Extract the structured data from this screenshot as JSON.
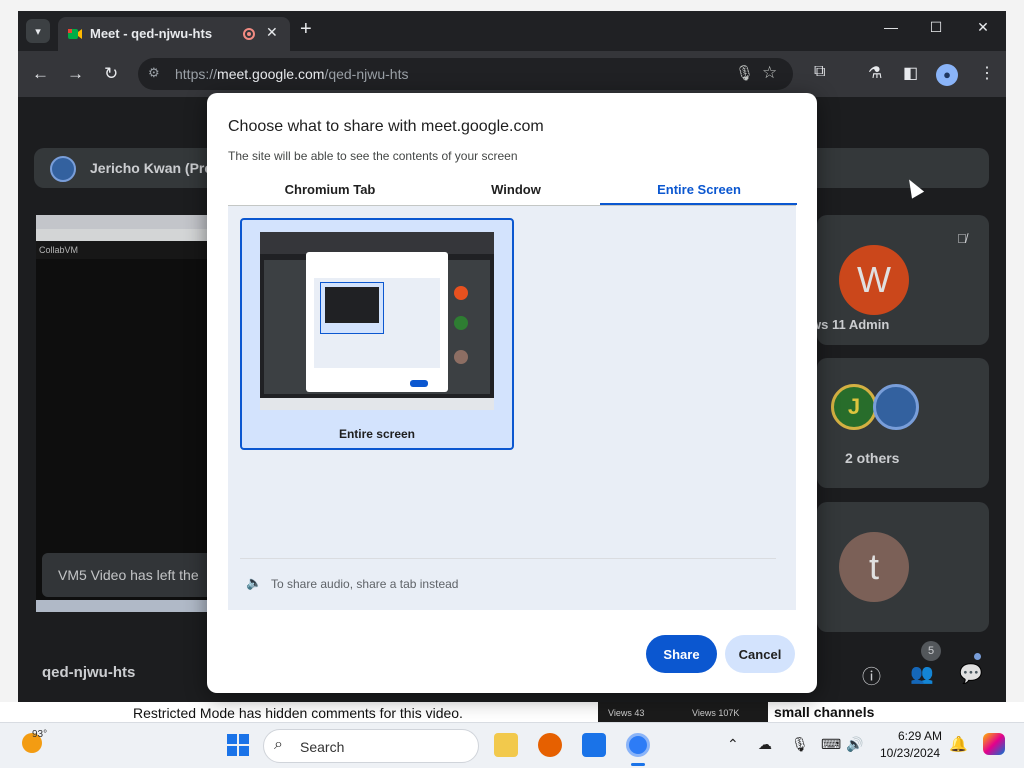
{
  "browser": {
    "tab_title": "Meet - qed-njwu-hts",
    "tab_close": "✕",
    "new_tab": "+",
    "window_controls": {
      "minimize": "—",
      "maximize": "☐",
      "close": "✕"
    },
    "nav": {
      "back": "←",
      "forward": "→",
      "reload": "↻"
    },
    "url_prefix": "https://",
    "url_host": "meet.google.com",
    "url_path": "/qed-njwu-hts",
    "toolbar_icons": [
      "mic-icon",
      "star-icon",
      "extensions-icon",
      "lab-icon",
      "side-panel-icon",
      "profile-icon",
      "menu-icon"
    ]
  },
  "meet": {
    "presenter_name": "Jericho Kwan (Pre",
    "shared_screen_label": "CollabVM",
    "toast": "VM5 Video has left the",
    "participants": [
      {
        "initial": "W",
        "name": "ws 11 Admin",
        "color": "#e8511f",
        "muted": true
      },
      {
        "initial": "J",
        "name": "2 others",
        "color": "#2e7d32"
      },
      {
        "initial": "t",
        "name": "",
        "color": "#8d6e63"
      }
    ],
    "meeting_code": "qed-njwu-hts",
    "people_count": "5"
  },
  "dialog": {
    "title": "Choose what to share with meet.google.com",
    "subtitle": "The site will be able to see the contents of your screen",
    "tabs": [
      {
        "label": "Chromium Tab",
        "selected": false
      },
      {
        "label": "Window",
        "selected": false
      },
      {
        "label": "Entire Screen",
        "selected": true
      }
    ],
    "source_label": "Entire screen",
    "audio_note": "To share audio, share a tab instead",
    "share_label": "Share",
    "cancel_label": "Cancel"
  },
  "background_page": {
    "restricted_text": "Restricted Mode has hidden comments for this video.",
    "views_left": "Views      43",
    "views_right": "Views   107K",
    "small_channels": "small channels"
  },
  "taskbar": {
    "temperature": "93°",
    "search_placeholder": "Search",
    "time": "6:29 AM",
    "date": "10/23/2024"
  },
  "colors": {
    "accent": "#0b57d0",
    "meet_bg": "#202124",
    "panel_bg": "#e9eef6"
  }
}
